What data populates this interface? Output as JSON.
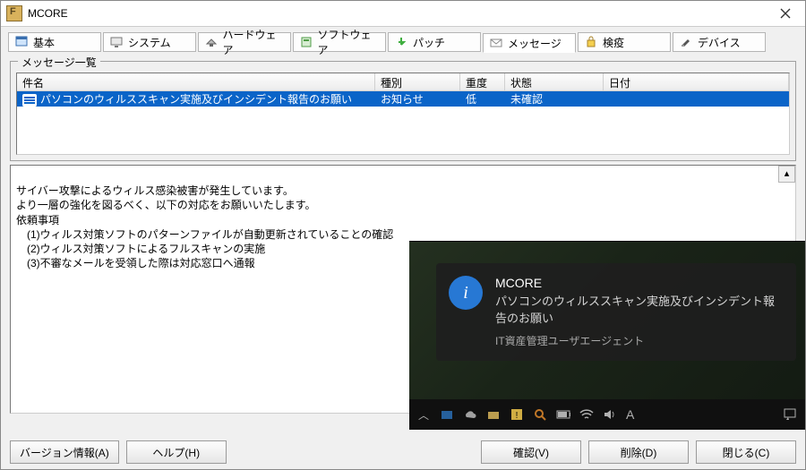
{
  "window": {
    "title": "MCORE"
  },
  "tabs": [
    {
      "label": "基本"
    },
    {
      "label": "システム"
    },
    {
      "label": "ハードウェア"
    },
    {
      "label": "ソフトウェア"
    },
    {
      "label": "パッチ"
    },
    {
      "label": "メッセージ"
    },
    {
      "label": "検疫"
    },
    {
      "label": "デバイス"
    }
  ],
  "group": {
    "legend": "メッセージ一覧"
  },
  "columns": {
    "subject": "件名",
    "type": "種別",
    "severity": "重度",
    "state": "状態",
    "date": "日付"
  },
  "rows": [
    {
      "subject": "パソコンのウィルススキャン実施及びインシデント報告のお願い",
      "type": "お知らせ",
      "severity": "低",
      "state": "未確認",
      "date": ""
    }
  ],
  "detail": "サイバー攻撃によるウィルス感染被害が発生しています。\nより一層の強化を図るべく、以下の対応をお願いいたします。\n依頼事項\n　(1)ウィルス対策ソフトのパターンファイルが自動更新されていることの確認\n　(2)ウィルス対策ソフトによるフルスキャンの実施\n　(3)不審なメールを受領した際は対応窓口へ通報",
  "buttons": {
    "version": "バージョン情報(A)",
    "help": "ヘルプ(H)",
    "confirm": "確認(V)",
    "delete": "削除(D)",
    "close": "閉じる(C)"
  },
  "toast": {
    "app": "MCORE",
    "message": "パソコンのウィルススキャン実施及びインシデント報告のお願い",
    "source": "IT資産管理ユーザエージェント"
  },
  "tray": {
    "ime": "A"
  }
}
